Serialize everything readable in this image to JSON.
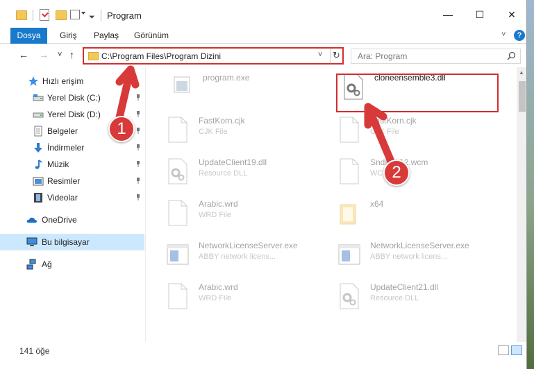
{
  "window": {
    "title": "Program",
    "minimize": "—",
    "maximize": "☐",
    "close": "✕"
  },
  "ribbon": {
    "tabs": [
      "Dosya",
      "Giriş",
      "Paylaş",
      "Görünüm"
    ],
    "expand": "˅",
    "help": "?"
  },
  "navigation": {
    "back": "←",
    "forward": "→",
    "recent": "˅",
    "up": "↑",
    "address": "C:\\Program Files\\Program Dizini",
    "address_dropdown": "˅",
    "refresh": "↻",
    "search_placeholder": "Ara: Program"
  },
  "sidebar": {
    "items": [
      {
        "label": "Hızlı erişim",
        "icon": "star-icon"
      },
      {
        "label": "Yerel Disk (C:)",
        "icon": "drive-icon",
        "pinned": true
      },
      {
        "label": "Yerel Disk (D:)",
        "icon": "drive-icon",
        "pinned": true
      },
      {
        "label": "Belgeler",
        "icon": "documents-icon",
        "pinned": true
      },
      {
        "label": "İndirmeler",
        "icon": "download-icon",
        "pinned": true
      },
      {
        "label": "Müzik",
        "icon": "music-icon",
        "pinned": true
      },
      {
        "label": "Resimler",
        "icon": "pictures-icon",
        "pinned": true
      },
      {
        "label": "Videolar",
        "icon": "video-icon",
        "pinned": true
      },
      {
        "label": "OneDrive",
        "icon": "cloud-icon"
      },
      {
        "label": "Bu bilgisayar",
        "icon": "computer-icon",
        "selected": true
      },
      {
        "label": "Ağ",
        "icon": "network-icon"
      }
    ]
  },
  "files": [
    {
      "name": "program.exe",
      "type": "",
      "icon": "exe-icon"
    },
    {
      "name": "cloneensemble3.dll",
      "type": "",
      "icon": "dll-gear-icon",
      "highlighted": true
    },
    {
      "name": "FastKorn.cjk",
      "type": "CJK File",
      "icon": "blank-file-icon"
    },
    {
      "name": "FastKorn.cjk",
      "type": "CJK File",
      "icon": "blank-file-icon"
    },
    {
      "name": "UpdateClient19.dll",
      "type": "Resource DLL",
      "icon": "dll-gear-icon"
    },
    {
      "name": "SndEdit12.wcm",
      "type": "WCM File",
      "icon": "blank-file-icon"
    },
    {
      "name": "Arabic.wrd",
      "type": "WRD File",
      "icon": "blank-file-icon"
    },
    {
      "name": "x64",
      "type": "",
      "icon": "folder-icon"
    },
    {
      "name": "NetworkLicenseServer.exe",
      "type": "ABBY network licens...",
      "icon": "app-window-icon"
    },
    {
      "name": "NetworkLicenseServer.exe",
      "type": "ABBY network licens...",
      "icon": "app-window-icon"
    },
    {
      "name": "Arabic.wrd",
      "type": "WRD File",
      "icon": "blank-file-icon"
    },
    {
      "name": "UpdateClient21.dll",
      "type": "Resource DLL",
      "icon": "dll-gear-icon"
    }
  ],
  "status": {
    "item_count": "141 öğe"
  },
  "annotations": [
    {
      "number": "1",
      "color": "#d83a3a"
    },
    {
      "number": "2",
      "color": "#d83a3a"
    }
  ]
}
